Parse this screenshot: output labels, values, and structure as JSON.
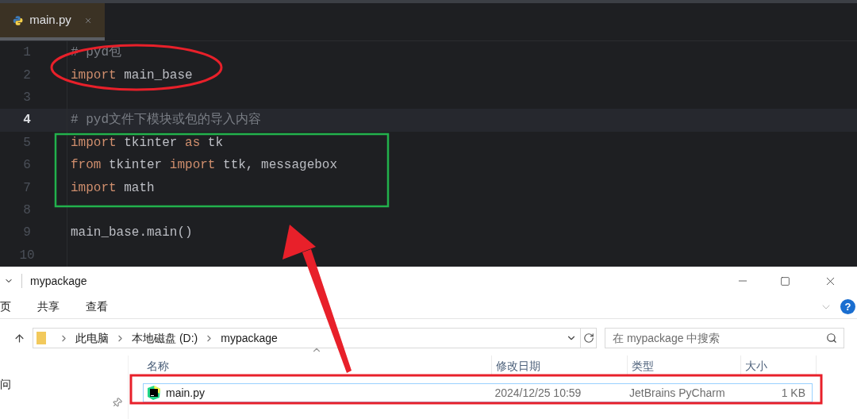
{
  "editor": {
    "tabs": [
      {
        "label": "main.py",
        "selected": true
      }
    ],
    "lines": [
      {
        "number": "1",
        "current": false,
        "tokens": [
          {
            "kind": "comment",
            "text": "# pyd包"
          }
        ]
      },
      {
        "number": "2",
        "current": false,
        "tokens": [
          {
            "kind": "keyword",
            "text": "import"
          },
          {
            "kind": "plain",
            "text": " main_base"
          }
        ]
      },
      {
        "number": "3",
        "current": false
      },
      {
        "number": "4",
        "current": true,
        "tokens": [
          {
            "kind": "comment",
            "text": "# pyd文件下模块或包的导入内容"
          }
        ]
      },
      {
        "number": "5",
        "current": false,
        "tokens": [
          {
            "kind": "keyword",
            "text": "import"
          },
          {
            "kind": "plain",
            "text": " tkinter "
          },
          {
            "kind": "keyword",
            "text": "as"
          },
          {
            "kind": "plain",
            "text": " tk"
          }
        ]
      },
      {
        "number": "6",
        "current": false,
        "tokens": [
          {
            "kind": "keyword",
            "text": "from"
          },
          {
            "kind": "plain",
            "text": " tkinter "
          },
          {
            "kind": "keyword",
            "text": "import"
          },
          {
            "kind": "plain",
            "text": " ttk, messagebox"
          }
        ]
      },
      {
        "number": "7",
        "current": false,
        "tokens": [
          {
            "kind": "keyword",
            "text": "import"
          },
          {
            "kind": "plain",
            "text": " math"
          }
        ]
      },
      {
        "number": "8",
        "current": false
      },
      {
        "number": "9",
        "current": false,
        "tokens": [
          {
            "kind": "plain",
            "text": "main_base.main()"
          }
        ]
      },
      {
        "number": "10",
        "current": false
      }
    ]
  },
  "explorer": {
    "title": "mypackage",
    "ribbon_tabs": [
      "页",
      "共享",
      "查看"
    ],
    "help": "?",
    "breadcrumbs": [
      "此电脑",
      "本地磁盘 (D:)",
      "mypackage"
    ],
    "search": {
      "placeholder": "在 mypackage 中搜索"
    },
    "nav_items": [
      "问"
    ],
    "columns": [
      "名称",
      "修改日期",
      "类型",
      "大小"
    ],
    "files": [
      {
        "name": "main.py",
        "modified": "2024/12/25 10:59",
        "type": "JetBrains PyCharm",
        "size": "1 KB"
      }
    ]
  }
}
